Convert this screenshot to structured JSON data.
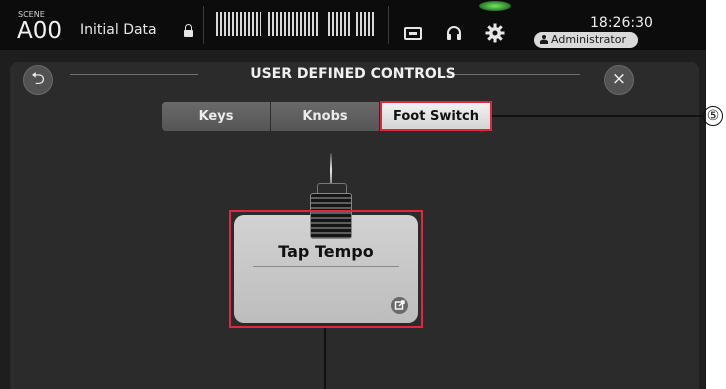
{
  "status": {
    "scene_label": "SCENE",
    "scene_number": "A00",
    "scene_title": "Initial Data",
    "time": "18:26:30",
    "user": "Administrator",
    "icons": [
      "lock-icon",
      "meter-bridge",
      "recorder-icon",
      "headphones-icon",
      "setup-gear-icon",
      "user-icon"
    ],
    "active_icon_color": "#5fd34f"
  },
  "dialog": {
    "title": "USER DEFINED CONTROLS",
    "back_glyph": "⮌",
    "close_glyph": "×"
  },
  "tabs": [
    {
      "label": "Keys",
      "selected": false
    },
    {
      "label": "Knobs",
      "selected": false
    },
    {
      "label": "Foot Switch",
      "selected": true
    }
  ],
  "foot_switch": {
    "function": "Tap Tempo"
  },
  "annotation": {
    "number": "⑤",
    "highlight_color": "#e0283a"
  }
}
